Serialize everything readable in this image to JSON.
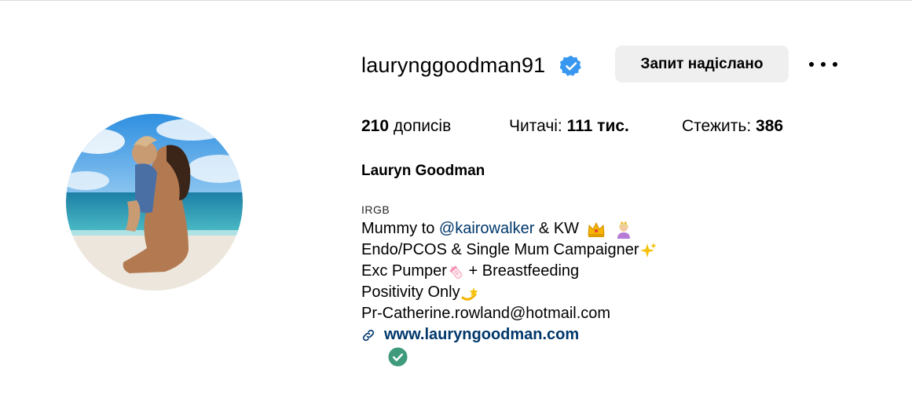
{
  "profile": {
    "username": "laurynggoodman91",
    "request_button": "Запит надіслано",
    "stats": {
      "posts_count": "210",
      "posts_label": "дописів",
      "followers_label": "Читачі:",
      "followers_count": "111 тис.",
      "following_label": "Стежить:",
      "following_count": "386"
    },
    "full_name": "Lauryn Goodman",
    "category": "IRGB",
    "bio": {
      "line1_prefix": "Mummy to ",
      "line1_mention": "@kairowalker",
      "line1_suffix": " & KW ",
      "line2": "Endo/PCOS & Single Mum Campaigner",
      "line3_prefix": "Exc Pumper",
      "line3_suffix": " + Breastfeeding",
      "line4": "Positivity Only",
      "line5": "Pr-Catherine.rowland@hotmail.com"
    },
    "website": "www.lauryngoodman.com"
  },
  "colors": {
    "verified_badge": "#3897f0",
    "link": "#00376b",
    "button_bg": "#efefef",
    "check_badge": "#3f9b7b"
  },
  "icons": [
    "verified-badge-icon",
    "more-options-icon",
    "crown-emoji",
    "princess-emoji",
    "sparkles-emoji",
    "baby-bottle-emoji",
    "dizzy-emoji",
    "link-icon",
    "check-circle-icon"
  ]
}
